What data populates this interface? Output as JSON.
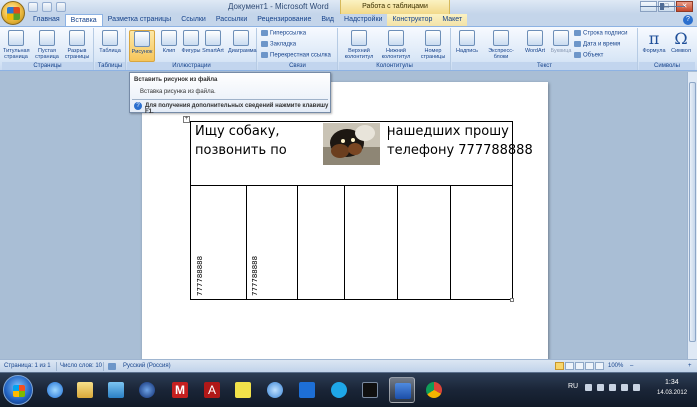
{
  "window": {
    "title": "Документ1 - Microsoft Word",
    "context_title": "Работа с таблицами",
    "minimize": "–",
    "maximize": "□",
    "close": "✕"
  },
  "tabs": [
    "Главная",
    "Вставка",
    "Разметка страницы",
    "Ссылки",
    "Рассылки",
    "Рецензирование",
    "Вид",
    "Надстройки",
    "Конструктор",
    "Макет"
  ],
  "active_tab": "Вставка",
  "ribbon": {
    "groups": {
      "pages": "Страницы",
      "tables": "Таблицы",
      "illustrations": "Иллюстрации",
      "links": "Связи",
      "headers": "Колонтитулы",
      "text": "Текст",
      "symbols": "Символы"
    },
    "buttons": {
      "title_page": "Титульная страница",
      "blank_page": "Пустая страница",
      "page_break": "Разрыв страницы",
      "table": "Таблица",
      "picture": "Рисунок",
      "clip": "Клип",
      "shapes": "Фигуры",
      "smartart": "SmartArt",
      "chart": "Диаграмма",
      "hyperlink": "Гиперссылка",
      "bookmark": "Закладка",
      "cross_ref": "Перекрестная ссылка",
      "header": "Верхний колонтитул",
      "footer": "Нижний колонтитул",
      "page_number": "Номер страницы",
      "textbox": "Надпись",
      "quick_parts": "Экспресс-блоки",
      "wordart": "WordArt",
      "dropcap": "Буквица",
      "signature_line": "Строка подписи",
      "date_time": "Дата и время",
      "object": "Объект",
      "formula": "Формула",
      "symbol": "Символ",
      "formula_glyph": "π",
      "symbol_glyph": "Ω"
    }
  },
  "tooltip": {
    "title": "Вставить рисунок из файла",
    "body": "Вставка рисунка из файла.",
    "help": "Для получения дополнительных сведений нажмите клавишу F1.",
    "help_glyph": "?"
  },
  "document": {
    "table_handle": "+",
    "cell1_line1": "Ищу собаку,",
    "cell1_line2": "позвонить по",
    "cell2_line1": "нашедших прошу",
    "cell2_line2": "телефону 777788888",
    "vertical_text": "777788888"
  },
  "statusbar": {
    "page": "Страница: 1 из 1",
    "words": "Число слов: 10",
    "language": "Русский (Россия)",
    "zoom": "100%",
    "zoom_minus": "–",
    "zoom_plus": "+"
  },
  "taskbar": {
    "lang": "RU",
    "time": "1:34",
    "date": "14.03.2012",
    "app_letters": {
      "m": "M",
      "a": "A"
    }
  },
  "colors": {
    "accent": "#15428b",
    "ribbon_bg": "#dbe8f7",
    "selected": "#f6c55a"
  }
}
